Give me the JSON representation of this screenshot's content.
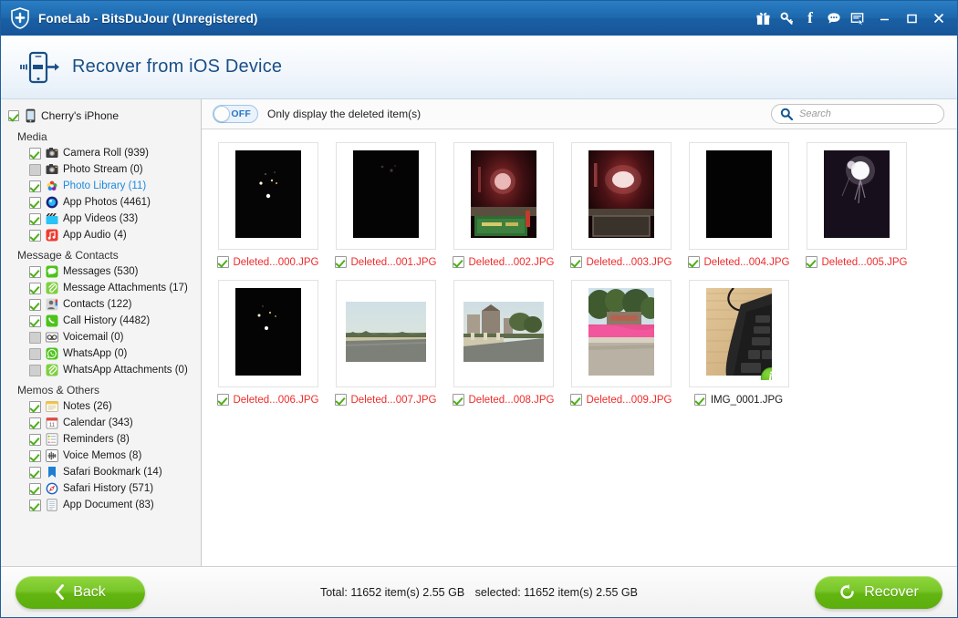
{
  "titlebar": {
    "title": "FoneLab - BitsDuJour (Unregistered)",
    "logo_icon": "shield-plus-icon",
    "icons": [
      {
        "name": "gift-icon",
        "glyph": "gift"
      },
      {
        "name": "key-icon",
        "glyph": "key"
      },
      {
        "name": "facebook-icon",
        "glyph": "f"
      },
      {
        "name": "chat-icon",
        "glyph": "chat"
      },
      {
        "name": "register-icon",
        "glyph": "form"
      }
    ],
    "window_buttons": [
      {
        "name": "minimize-button",
        "glyph": "minimize"
      },
      {
        "name": "maximize-button",
        "glyph": "maximize"
      },
      {
        "name": "close-button",
        "glyph": "close"
      }
    ]
  },
  "header": {
    "icon": "ios-device-transfer-icon",
    "title": "Recover from iOS Device"
  },
  "sidebar": {
    "device": {
      "label": "Cherry's iPhone",
      "checked": true,
      "icon": "iphone-icon"
    },
    "groups": [
      {
        "title": "Media",
        "items": [
          {
            "label": "Camera Roll (939)",
            "checked": true,
            "selected": false,
            "icon": "camera-icon"
          },
          {
            "label": "Photo Stream (0)",
            "checked": false,
            "selected": false,
            "icon": "camera-icon"
          },
          {
            "label": "Photo Library (11)",
            "checked": true,
            "selected": true,
            "icon": "photo-library-icon"
          },
          {
            "label": "App Photos (4461)",
            "checked": true,
            "selected": false,
            "icon": "app-photos-icon"
          },
          {
            "label": "App Videos (33)",
            "checked": true,
            "selected": false,
            "icon": "app-videos-icon"
          },
          {
            "label": "App Audio (4)",
            "checked": true,
            "selected": false,
            "icon": "app-audio-icon"
          }
        ]
      },
      {
        "title": "Message & Contacts",
        "items": [
          {
            "label": "Messages (530)",
            "checked": true,
            "selected": false,
            "icon": "messages-icon"
          },
          {
            "label": "Message Attachments (17)",
            "checked": true,
            "selected": false,
            "icon": "attachment-icon"
          },
          {
            "label": "Contacts (122)",
            "checked": true,
            "selected": false,
            "icon": "contacts-icon"
          },
          {
            "label": "Call History (4482)",
            "checked": true,
            "selected": false,
            "icon": "phone-icon"
          },
          {
            "label": "Voicemail (0)",
            "checked": false,
            "selected": false,
            "icon": "voicemail-icon"
          },
          {
            "label": "WhatsApp (0)",
            "checked": false,
            "selected": false,
            "icon": "whatsapp-icon"
          },
          {
            "label": "WhatsApp Attachments (0)",
            "checked": false,
            "selected": false,
            "icon": "attachment-icon"
          }
        ]
      },
      {
        "title": "Memos & Others",
        "items": [
          {
            "label": "Notes (26)",
            "checked": true,
            "selected": false,
            "icon": "notes-icon"
          },
          {
            "label": "Calendar (343)",
            "checked": true,
            "selected": false,
            "icon": "calendar-icon"
          },
          {
            "label": "Reminders (8)",
            "checked": true,
            "selected": false,
            "icon": "reminders-icon"
          },
          {
            "label": "Voice Memos (8)",
            "checked": true,
            "selected": false,
            "icon": "voice-memos-icon"
          },
          {
            "label": "Safari Bookmark (14)",
            "checked": true,
            "selected": false,
            "icon": "bookmark-icon"
          },
          {
            "label": "Safari History (571)",
            "checked": true,
            "selected": false,
            "icon": "safari-icon"
          },
          {
            "label": "App Document (83)",
            "checked": true,
            "selected": false,
            "icon": "document-icon"
          }
        ]
      }
    ]
  },
  "toolbar": {
    "toggle_state": "OFF",
    "toggle_label": "Only display the deleted item(s)",
    "search_placeholder": "Search",
    "search_value": "",
    "search_icon": "search-icon"
  },
  "grid": {
    "items": [
      {
        "filename": "Deleted...000.JPG",
        "checked": true,
        "deleted": true,
        "thumb": "night-lights",
        "has_info": false
      },
      {
        "filename": "Deleted...001.JPG",
        "checked": true,
        "deleted": true,
        "thumb": "night-dark",
        "has_info": false
      },
      {
        "filename": "Deleted...002.JPG",
        "checked": true,
        "deleted": true,
        "thumb": "firework-green-sign",
        "has_info": false
      },
      {
        "filename": "Deleted...003.JPG",
        "checked": true,
        "deleted": true,
        "thumb": "firework-red",
        "has_info": false
      },
      {
        "filename": "Deleted...004.JPG",
        "checked": true,
        "deleted": true,
        "thumb": "black",
        "has_info": false
      },
      {
        "filename": "Deleted...005.JPG",
        "checked": true,
        "deleted": true,
        "thumb": "firework-white",
        "has_info": false
      },
      {
        "filename": "Deleted...006.JPG",
        "checked": true,
        "deleted": true,
        "thumb": "night-lights2",
        "has_info": false
      },
      {
        "filename": "Deleted...007.JPG",
        "checked": true,
        "deleted": true,
        "thumb": "road-1",
        "has_info": false
      },
      {
        "filename": "Deleted...008.JPG",
        "checked": true,
        "deleted": true,
        "thumb": "road-2",
        "has_info": false
      },
      {
        "filename": "Deleted...009.JPG",
        "checked": true,
        "deleted": true,
        "thumb": "flowers",
        "has_info": false
      },
      {
        "filename": "IMG_0001.JPG",
        "checked": true,
        "deleted": false,
        "thumb": "desk-phone",
        "has_info": true,
        "info_glyph": "i"
      }
    ]
  },
  "bottombar": {
    "back_label": "Back",
    "back_icon": "chevron-left-icon",
    "recover_label": "Recover",
    "recover_icon": "restore-icon",
    "total_text": "Total: 11652 item(s) 2.55 GB",
    "selected_text": "selected: 11652 item(s) 2.55 GB"
  },
  "colors": {
    "title_blue": "#1d68ad",
    "accent_green": "#6cc21a",
    "deleted_red": "#ef2b2b",
    "selected_blue": "#1c8ae0"
  }
}
